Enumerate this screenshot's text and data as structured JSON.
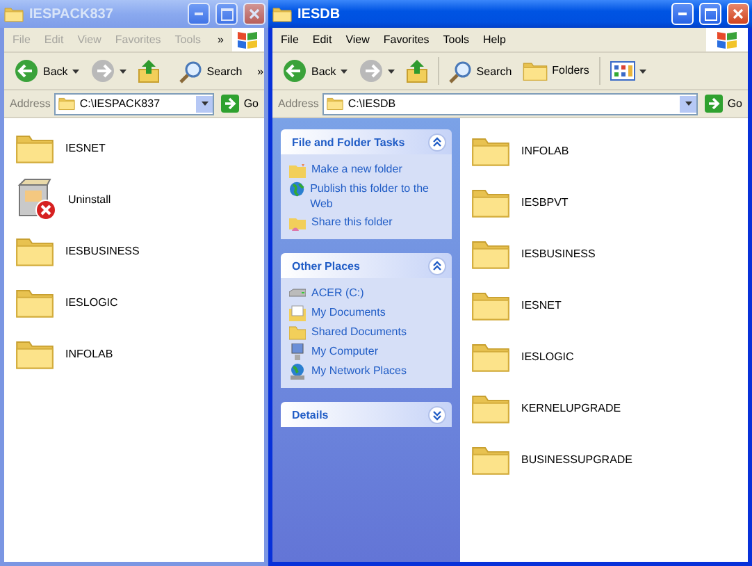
{
  "windows": [
    {
      "title": "IESPACK837",
      "active": false,
      "menu": [
        "File",
        "Edit",
        "View",
        "Favorites",
        "Tools"
      ],
      "menu_more": "»",
      "toolbar": [
        {
          "kind": "back",
          "label": "Back"
        },
        {
          "kind": "forward",
          "disabled": true
        },
        {
          "kind": "up"
        },
        {
          "kind": "search",
          "label": "Search"
        }
      ],
      "toolbar_more": "»",
      "address_label": "Address",
      "address": "C:\\IESPACK837",
      "go": "Go",
      "items": [
        {
          "kind": "folder",
          "name": "IESNET"
        },
        {
          "kind": "uninstaller",
          "name": "Uninstall"
        },
        {
          "kind": "folder",
          "name": "IESBUSINESS"
        },
        {
          "kind": "folder",
          "name": "IESLOGIC"
        },
        {
          "kind": "folder",
          "name": "INFOLAB"
        }
      ]
    },
    {
      "title": "IESDB",
      "active": true,
      "menu": [
        "File",
        "Edit",
        "View",
        "Favorites",
        "Tools",
        "Help"
      ],
      "toolbar": [
        {
          "kind": "back",
          "label": "Back"
        },
        {
          "kind": "forward",
          "disabled": true
        },
        {
          "kind": "up"
        },
        {
          "kind": "search",
          "label": "Search"
        },
        {
          "kind": "folders",
          "label": "Folders"
        },
        {
          "kind": "views"
        }
      ],
      "address_label": "Address",
      "address": "C:\\IESDB",
      "go": "Go",
      "tasks": [
        {
          "title": "File and Folder Tasks",
          "expanded": true,
          "items": [
            {
              "kind": "newfolder",
              "label": "Make a new folder"
            },
            {
              "kind": "globe",
              "label": "Publish this folder to the Web"
            },
            {
              "kind": "share",
              "label": "Share this folder"
            }
          ]
        },
        {
          "title": "Other Places",
          "expanded": true,
          "items": [
            {
              "kind": "drive",
              "label": "ACER (C:)"
            },
            {
              "kind": "documents",
              "label": "My Documents"
            },
            {
              "kind": "folder",
              "label": "Shared Documents"
            },
            {
              "kind": "computer",
              "label": "My Computer"
            },
            {
              "kind": "network",
              "label": "My Network Places"
            }
          ]
        },
        {
          "title": "Details",
          "expanded": false
        }
      ],
      "items": [
        {
          "kind": "folder",
          "name": "INFOLAB"
        },
        {
          "kind": "folder",
          "name": "IESBPVT"
        },
        {
          "kind": "folder",
          "name": "IESBUSINESS"
        },
        {
          "kind": "folder",
          "name": "IESNET"
        },
        {
          "kind": "folder",
          "name": "IESLOGIC"
        },
        {
          "kind": "folder",
          "name": "KERNELUPGRADE"
        },
        {
          "kind": "folder",
          "name": "BUSINESSUPGRADE"
        }
      ]
    }
  ]
}
